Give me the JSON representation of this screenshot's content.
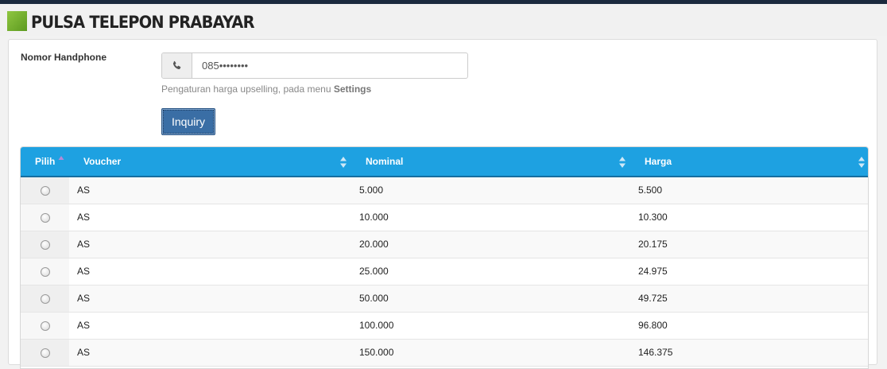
{
  "header": {
    "title": "PULSA TELEPON PRABAYAR"
  },
  "form": {
    "phone_label": "Nomor Handphone",
    "phone_value": "085••••••••",
    "phone_icon": "phone-icon",
    "help_text": "Pengaturan harga upselling, pada menu ",
    "help_link": "Settings",
    "inquiry_label": "Inquiry"
  },
  "table": {
    "columns": [
      "Pilih",
      "Voucher",
      "Nominal",
      "Harga"
    ],
    "rows": [
      {
        "voucher": "AS",
        "nominal": "5.000",
        "harga": "5.500"
      },
      {
        "voucher": "AS",
        "nominal": "10.000",
        "harga": "10.300"
      },
      {
        "voucher": "AS",
        "nominal": "20.000",
        "harga": "20.175"
      },
      {
        "voucher": "AS",
        "nominal": "25.000",
        "harga": "24.975"
      },
      {
        "voucher": "AS",
        "nominal": "50.000",
        "harga": "49.725"
      },
      {
        "voucher": "AS",
        "nominal": "100.000",
        "harga": "96.800"
      },
      {
        "voucher": "AS",
        "nominal": "150.000",
        "harga": "146.375"
      }
    ]
  },
  "colors": {
    "header_blue": "#1ea1e1",
    "button_blue": "#3a6ea5",
    "title_green": "#7ab634"
  }
}
